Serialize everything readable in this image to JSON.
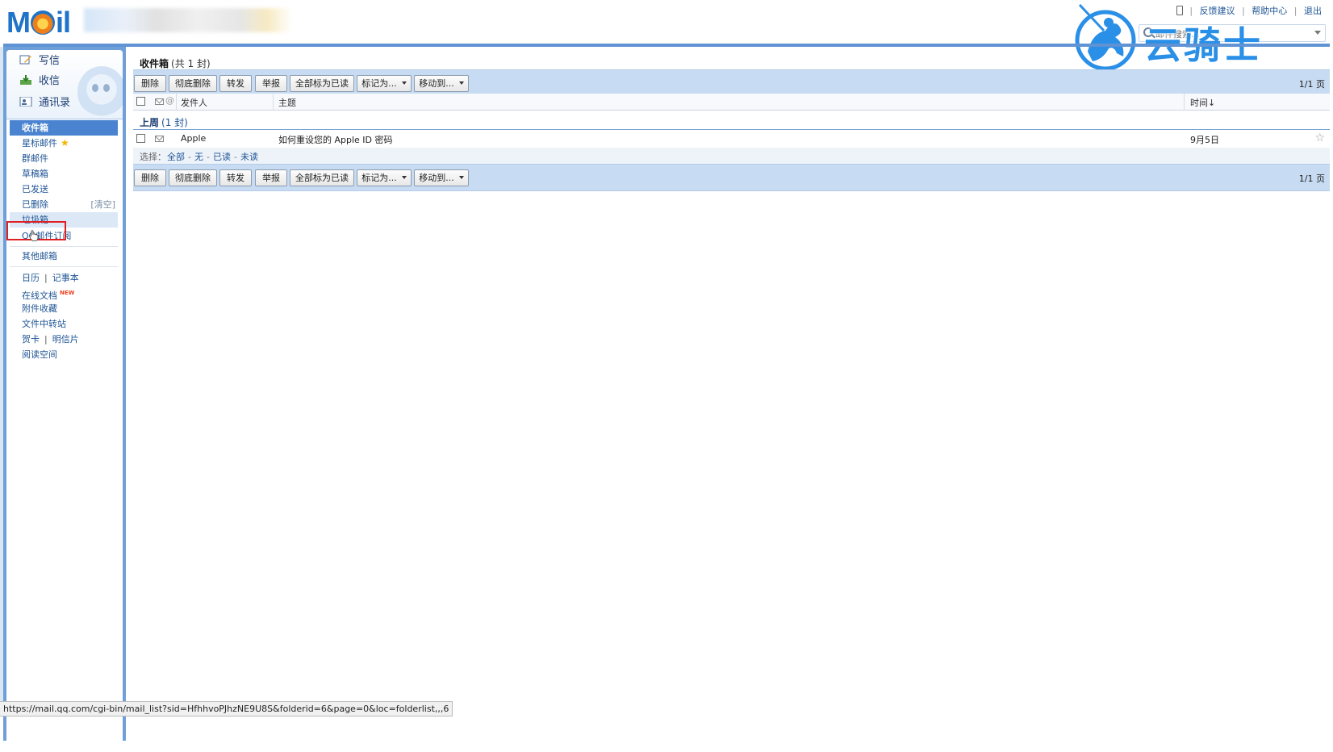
{
  "header": {
    "logo": {
      "m": "M",
      "o": "",
      "i": "i",
      "l": "l"
    },
    "top_links": [
      "反馈建议",
      "帮助中心",
      "退出"
    ],
    "search_placeholder": "邮件搜索..."
  },
  "watermark": {
    "text": "云骑士"
  },
  "quick_actions": [
    {
      "label": "写信",
      "icon": "compose-icon"
    },
    {
      "label": "收信",
      "icon": "receive-icon"
    },
    {
      "label": "通讯录",
      "icon": "contacts-icon"
    }
  ],
  "folders": {
    "inbox": "收件箱",
    "starred": "星标邮件",
    "group": "群邮件",
    "drafts": "草稿箱",
    "sent": "已发送",
    "deleted": "已删除",
    "deleted_action": "[清空]",
    "spam": "垃圾箱",
    "qq_subscribe": "QQ邮件订阅",
    "other": "其他邮箱"
  },
  "tools": {
    "calendar": "日历",
    "notes": "记事本",
    "online_docs": "在线文档",
    "new_badge": "NEW",
    "attachments": "附件收藏",
    "file_transfer": "文件中转站",
    "greeting_card": "贺卡",
    "postcard": "明信片",
    "reading_space": "阅读空间",
    "divider": "|"
  },
  "main": {
    "title": "收件箱",
    "count_text": "(共 1 封)",
    "toolbar": {
      "delete": "删除",
      "perm_delete": "彻底删除",
      "forward": "转发",
      "report": "举报",
      "mark_all_read": "全部标为已读",
      "mark_as": "标记为...",
      "move_to": "移动到..."
    },
    "pager": "1/1 页",
    "columns": {
      "sender": "发件人",
      "subject": "主题",
      "time": "时间↓"
    },
    "group": {
      "label": "上周",
      "count": "(1 封)"
    },
    "mails": [
      {
        "sender": "Apple",
        "subject": "如何重设您的 Apple ID 密码",
        "date": "9月5日",
        "read": true,
        "starred": false
      }
    ],
    "select": {
      "label": "选择：",
      "all": "全部",
      "none": "无",
      "read": "已读",
      "unread": "未读",
      "sep": "-"
    }
  },
  "status_bar": {
    "url": "https://mail.qq.com/cgi-bin/mail_list?sid=HfhhvoPJhzNE9U8S&folderid=6&page=0&loc=folderlist,,,6"
  },
  "colors": {
    "accent": "#4a83cf",
    "toolbar_bg": "#c7dbf2",
    "sidebar_frame": "#6f9fd8",
    "highlight": "#e02020"
  }
}
